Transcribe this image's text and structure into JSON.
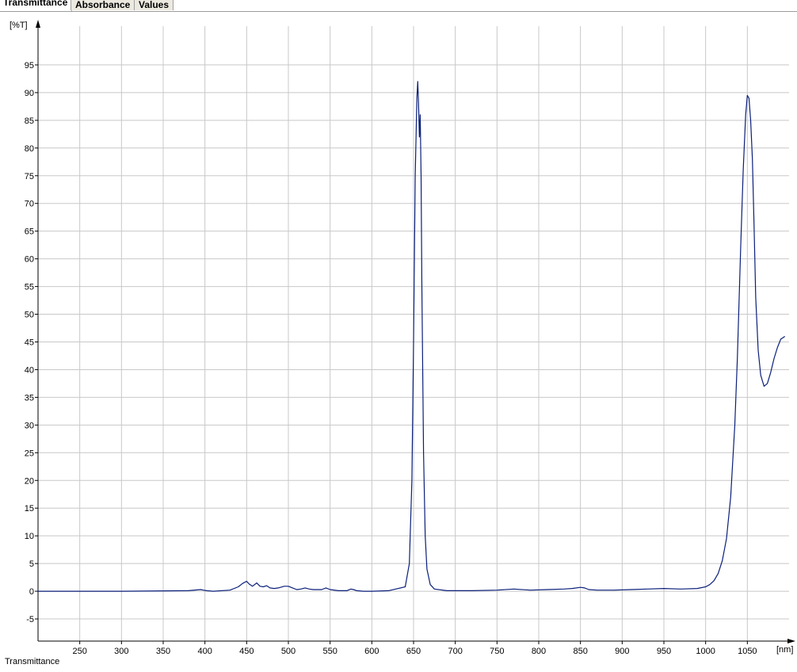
{
  "tabs": [
    {
      "label": "Transmittance",
      "active": true
    },
    {
      "label": "Absorbance",
      "active": false
    },
    {
      "label": "Values",
      "active": false
    }
  ],
  "footer_label": "Transmittance",
  "colors": {
    "line": "#0a1f7a",
    "grid": "#c8c8c8",
    "axis": "#000000"
  },
  "chart_data": {
    "type": "line",
    "title": "",
    "xlabel": "[nm]",
    "ylabel": "[%T]",
    "xlim": [
      200,
      1100
    ],
    "ylim": [
      -9,
      102
    ],
    "xticks": [
      250,
      300,
      350,
      400,
      450,
      500,
      550,
      600,
      650,
      700,
      750,
      800,
      850,
      900,
      950,
      1000,
      1050
    ],
    "yticks": [
      -5,
      0,
      5,
      10,
      15,
      20,
      25,
      30,
      35,
      40,
      45,
      50,
      55,
      60,
      65,
      70,
      75,
      80,
      85,
      90,
      95
    ],
    "grid": true,
    "series": [
      {
        "name": "",
        "x": [
          200,
          300,
          380,
          395,
          398,
          402,
          410,
          430,
          440,
          445,
          450,
          453,
          457,
          462,
          466,
          470,
          474,
          478,
          483,
          488,
          495,
          500,
          505,
          510,
          515,
          520,
          525,
          530,
          540,
          545,
          550,
          560,
          570,
          575,
          578,
          582,
          590,
          600,
          620,
          640,
          645,
          648,
          650,
          652,
          654,
          655,
          656,
          657,
          658,
          659,
          660,
          662,
          664,
          666,
          670,
          675,
          690,
          720,
          750,
          770,
          790,
          810,
          830,
          840,
          850,
          855,
          860,
          870,
          890,
          910,
          930,
          950,
          970,
          990,
          1000,
          1005,
          1010,
          1015,
          1020,
          1025,
          1030,
          1035,
          1038,
          1042,
          1045,
          1048,
          1050,
          1052,
          1054,
          1056,
          1058,
          1060,
          1063,
          1066,
          1070,
          1074,
          1078,
          1082,
          1086,
          1090,
          1095
        ],
        "y": [
          0,
          0,
          0.1,
          0.3,
          0.2,
          0.1,
          0,
          0.2,
          0.8,
          1.4,
          1.8,
          1.3,
          0.9,
          1.5,
          0.9,
          0.8,
          1.0,
          0.6,
          0.5,
          0.6,
          0.9,
          0.9,
          0.6,
          0.3,
          0.4,
          0.6,
          0.4,
          0.3,
          0.3,
          0.6,
          0.3,
          0.1,
          0.1,
          0.4,
          0.3,
          0.1,
          0,
          0,
          0.1,
          0.8,
          5,
          20,
          45,
          75,
          89,
          92,
          88,
          82,
          86,
          75,
          55,
          25,
          10,
          4,
          1.2,
          0.4,
          0.1,
          0.1,
          0.2,
          0.4,
          0.2,
          0.3,
          0.4,
          0.5,
          0.7,
          0.6,
          0.3,
          0.2,
          0.2,
          0.3,
          0.4,
          0.5,
          0.4,
          0.5,
          0.8,
          1.2,
          1.9,
          3.2,
          5.5,
          9.5,
          17,
          30,
          42,
          62,
          76,
          86,
          89.5,
          89,
          85,
          78,
          66,
          53,
          43.5,
          39,
          37,
          37.5,
          39.5,
          42,
          44,
          45.5,
          46
        ]
      }
    ]
  }
}
